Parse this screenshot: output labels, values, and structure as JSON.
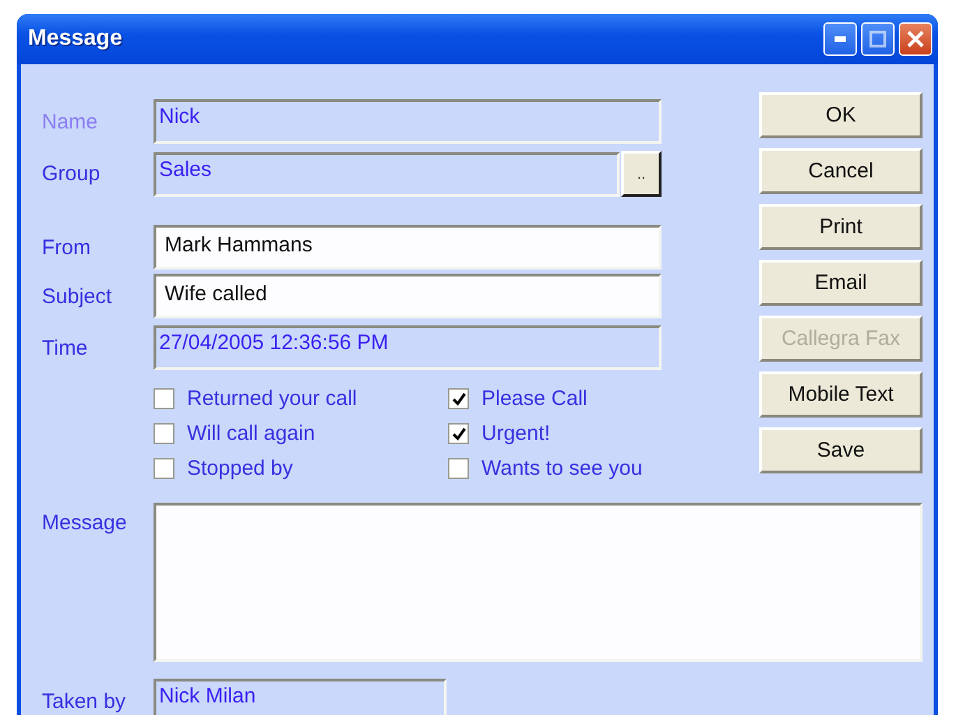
{
  "window": {
    "title": "Message"
  },
  "fields": [
    {
      "label": "Name",
      "value": "Nick",
      "kind": "readonly",
      "disabled": true
    },
    {
      "label": "Group",
      "value": "Sales",
      "kind": "readonly",
      "disabled": false,
      "browse": ".."
    },
    {
      "label": "From",
      "value": "Mark Hammans",
      "kind": "editable",
      "disabled": false
    },
    {
      "label": "Subject",
      "value": "Wife called",
      "kind": "editable",
      "disabled": false
    },
    {
      "label": "Time",
      "value": "27/04/2005 12:36:56 PM",
      "kind": "readonly",
      "disabled": false
    }
  ],
  "checkboxes": [
    {
      "label": "Returned your call",
      "checked": false
    },
    {
      "label": "Please Call",
      "checked": true
    },
    {
      "label": "Will call again",
      "checked": false
    },
    {
      "label": "Urgent!",
      "checked": true
    },
    {
      "label": "Stopped by",
      "checked": false
    },
    {
      "label": "Wants to see you",
      "checked": false
    }
  ],
  "buttons": [
    {
      "label": "OK",
      "disabled": false
    },
    {
      "label": "Cancel",
      "disabled": false
    },
    {
      "label": "Print",
      "disabled": false
    },
    {
      "label": "Email",
      "disabled": false
    },
    {
      "label": "Callegra Fax",
      "disabled": true
    },
    {
      "label": "Mobile Text",
      "disabled": false
    },
    {
      "label": "Save",
      "disabled": false
    }
  ],
  "message": {
    "label": "Message"
  },
  "taken_by": {
    "label": "Taken by",
    "value": "Nick Milan"
  }
}
